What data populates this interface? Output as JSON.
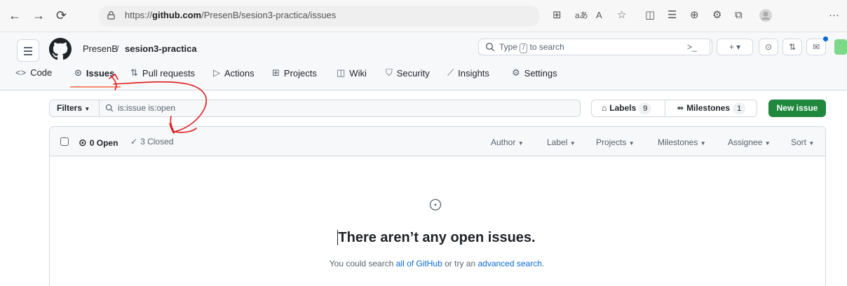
{
  "browser": {
    "url_prefix": "https://",
    "url_host": "github.com",
    "url_path": "/PresenB/sesion3-practica/issues"
  },
  "header": {
    "owner": "PresenB",
    "separator": "/",
    "repo": "sesion3-practica",
    "search_prefix": "Type",
    "search_key": "/",
    "search_suffix": "to search",
    "new_button": "+ ▾"
  },
  "tabs": [
    {
      "label": "Code",
      "icon": "code-icon"
    },
    {
      "label": "Issues",
      "icon": "issue-opened-icon"
    },
    {
      "label": "Pull requests",
      "icon": "pull-request-icon"
    },
    {
      "label": "Actions",
      "icon": "play-icon"
    },
    {
      "label": "Projects",
      "icon": "table-icon"
    },
    {
      "label": "Wiki",
      "icon": "book-icon"
    },
    {
      "label": "Security",
      "icon": "shield-icon"
    },
    {
      "label": "Insights",
      "icon": "graph-icon"
    },
    {
      "label": "Settings",
      "icon": "gear-icon"
    }
  ],
  "filters": {
    "button": "Filters",
    "query": "is:issue is:open",
    "labels": "Labels",
    "labels_count": "9",
    "milestones": "Milestones",
    "milestones_count": "1",
    "new_issue": "New issue"
  },
  "issues_header": {
    "open": "0 Open",
    "closed": "3 Closed",
    "menus": [
      "Author",
      "Label",
      "Projects",
      "Milestones",
      "Assignee",
      "Sort"
    ]
  },
  "blank": {
    "title": "There aren’t any open issues.",
    "desc_1": "You could search",
    "link_1": "all of GitHub",
    "desc_2": "or try an",
    "link_2": "advanced search",
    "desc_3": "."
  },
  "colors": {
    "primary": "#1f883d",
    "link": "#0969da",
    "annotation": "#e0191c",
    "tab_underline": "#fd8c73"
  }
}
